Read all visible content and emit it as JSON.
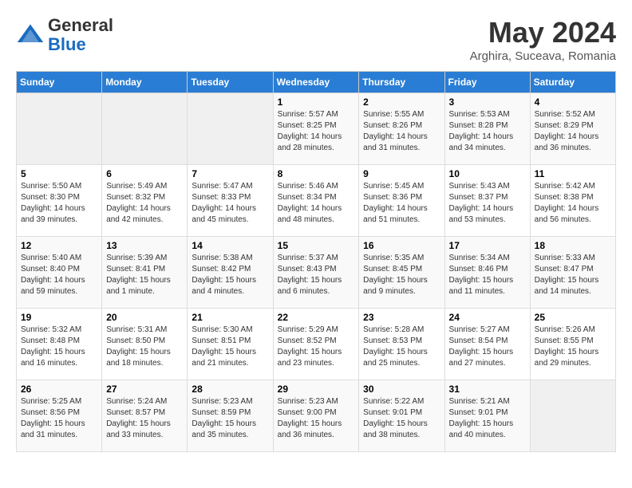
{
  "logo": {
    "general": "General",
    "blue": "Blue"
  },
  "title": "May 2024",
  "location": "Arghira, Suceava, Romania",
  "days_header": [
    "Sunday",
    "Monday",
    "Tuesday",
    "Wednesday",
    "Thursday",
    "Friday",
    "Saturday"
  ],
  "weeks": [
    [
      {
        "day": "",
        "info": ""
      },
      {
        "day": "",
        "info": ""
      },
      {
        "day": "",
        "info": ""
      },
      {
        "day": "1",
        "info": "Sunrise: 5:57 AM\nSunset: 8:25 PM\nDaylight: 14 hours\nand 28 minutes."
      },
      {
        "day": "2",
        "info": "Sunrise: 5:55 AM\nSunset: 8:26 PM\nDaylight: 14 hours\nand 31 minutes."
      },
      {
        "day": "3",
        "info": "Sunrise: 5:53 AM\nSunset: 8:28 PM\nDaylight: 14 hours\nand 34 minutes."
      },
      {
        "day": "4",
        "info": "Sunrise: 5:52 AM\nSunset: 8:29 PM\nDaylight: 14 hours\nand 36 minutes."
      }
    ],
    [
      {
        "day": "5",
        "info": "Sunrise: 5:50 AM\nSunset: 8:30 PM\nDaylight: 14 hours\nand 39 minutes."
      },
      {
        "day": "6",
        "info": "Sunrise: 5:49 AM\nSunset: 8:32 PM\nDaylight: 14 hours\nand 42 minutes."
      },
      {
        "day": "7",
        "info": "Sunrise: 5:47 AM\nSunset: 8:33 PM\nDaylight: 14 hours\nand 45 minutes."
      },
      {
        "day": "8",
        "info": "Sunrise: 5:46 AM\nSunset: 8:34 PM\nDaylight: 14 hours\nand 48 minutes."
      },
      {
        "day": "9",
        "info": "Sunrise: 5:45 AM\nSunset: 8:36 PM\nDaylight: 14 hours\nand 51 minutes."
      },
      {
        "day": "10",
        "info": "Sunrise: 5:43 AM\nSunset: 8:37 PM\nDaylight: 14 hours\nand 53 minutes."
      },
      {
        "day": "11",
        "info": "Sunrise: 5:42 AM\nSunset: 8:38 PM\nDaylight: 14 hours\nand 56 minutes."
      }
    ],
    [
      {
        "day": "12",
        "info": "Sunrise: 5:40 AM\nSunset: 8:40 PM\nDaylight: 14 hours\nand 59 minutes."
      },
      {
        "day": "13",
        "info": "Sunrise: 5:39 AM\nSunset: 8:41 PM\nDaylight: 15 hours\nand 1 minute."
      },
      {
        "day": "14",
        "info": "Sunrise: 5:38 AM\nSunset: 8:42 PM\nDaylight: 15 hours\nand 4 minutes."
      },
      {
        "day": "15",
        "info": "Sunrise: 5:37 AM\nSunset: 8:43 PM\nDaylight: 15 hours\nand 6 minutes."
      },
      {
        "day": "16",
        "info": "Sunrise: 5:35 AM\nSunset: 8:45 PM\nDaylight: 15 hours\nand 9 minutes."
      },
      {
        "day": "17",
        "info": "Sunrise: 5:34 AM\nSunset: 8:46 PM\nDaylight: 15 hours\nand 11 minutes."
      },
      {
        "day": "18",
        "info": "Sunrise: 5:33 AM\nSunset: 8:47 PM\nDaylight: 15 hours\nand 14 minutes."
      }
    ],
    [
      {
        "day": "19",
        "info": "Sunrise: 5:32 AM\nSunset: 8:48 PM\nDaylight: 15 hours\nand 16 minutes."
      },
      {
        "day": "20",
        "info": "Sunrise: 5:31 AM\nSunset: 8:50 PM\nDaylight: 15 hours\nand 18 minutes."
      },
      {
        "day": "21",
        "info": "Sunrise: 5:30 AM\nSunset: 8:51 PM\nDaylight: 15 hours\nand 21 minutes."
      },
      {
        "day": "22",
        "info": "Sunrise: 5:29 AM\nSunset: 8:52 PM\nDaylight: 15 hours\nand 23 minutes."
      },
      {
        "day": "23",
        "info": "Sunrise: 5:28 AM\nSunset: 8:53 PM\nDaylight: 15 hours\nand 25 minutes."
      },
      {
        "day": "24",
        "info": "Sunrise: 5:27 AM\nSunset: 8:54 PM\nDaylight: 15 hours\nand 27 minutes."
      },
      {
        "day": "25",
        "info": "Sunrise: 5:26 AM\nSunset: 8:55 PM\nDaylight: 15 hours\nand 29 minutes."
      }
    ],
    [
      {
        "day": "26",
        "info": "Sunrise: 5:25 AM\nSunset: 8:56 PM\nDaylight: 15 hours\nand 31 minutes."
      },
      {
        "day": "27",
        "info": "Sunrise: 5:24 AM\nSunset: 8:57 PM\nDaylight: 15 hours\nand 33 minutes."
      },
      {
        "day": "28",
        "info": "Sunrise: 5:23 AM\nSunset: 8:59 PM\nDaylight: 15 hours\nand 35 minutes."
      },
      {
        "day": "29",
        "info": "Sunrise: 5:23 AM\nSunset: 9:00 PM\nDaylight: 15 hours\nand 36 minutes."
      },
      {
        "day": "30",
        "info": "Sunrise: 5:22 AM\nSunset: 9:01 PM\nDaylight: 15 hours\nand 38 minutes."
      },
      {
        "day": "31",
        "info": "Sunrise: 5:21 AM\nSunset: 9:01 PM\nDaylight: 15 hours\nand 40 minutes."
      },
      {
        "day": "",
        "info": ""
      }
    ]
  ]
}
